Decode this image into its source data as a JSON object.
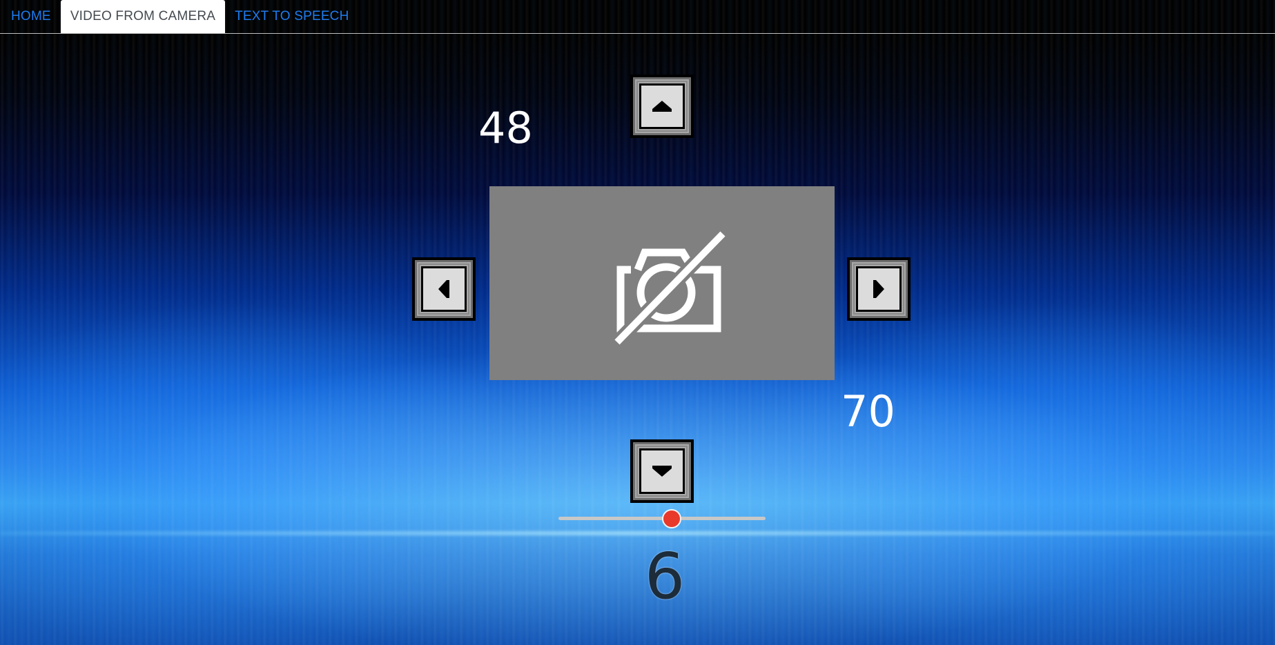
{
  "nav": {
    "tabs": [
      {
        "label": "HOME",
        "active": false
      },
      {
        "label": "VIDEO FROM CAMERA",
        "active": true
      },
      {
        "label": "TEXT TO SPEECH",
        "active": false
      }
    ]
  },
  "camera": {
    "icon": "camera-off-icon",
    "pan_value": "48",
    "tilt_value": "70"
  },
  "controls": {
    "up_icon": "arrow-up-icon",
    "down_icon": "arrow-down-icon",
    "left_icon": "arrow-left-icon",
    "right_icon": "arrow-right-icon"
  },
  "slider": {
    "value": 6,
    "value_label": "6",
    "min": 0,
    "max": 11
  },
  "colors": {
    "accent_link": "#1e7cf0",
    "slider_thumb": "#e8392b",
    "camera_placeholder_bg": "#808080"
  }
}
